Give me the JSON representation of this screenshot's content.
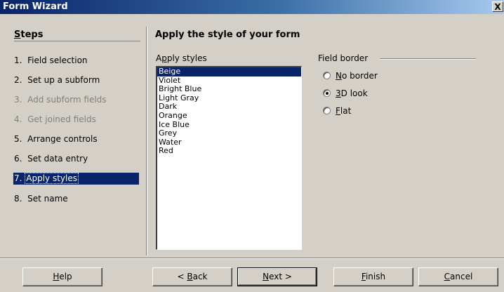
{
  "window": {
    "title": "Form Wizard",
    "close_label": "X"
  },
  "steps": {
    "title": "Steps",
    "items": [
      {
        "number": "1.",
        "label": "Field selection",
        "state": "enabled"
      },
      {
        "number": "2.",
        "label": "Set up a subform",
        "state": "enabled"
      },
      {
        "number": "3.",
        "label": "Add subform fields",
        "state": "disabled"
      },
      {
        "number": "4.",
        "label": "Get joined fields",
        "state": "disabled"
      },
      {
        "number": "5.",
        "label": "Arrange controls",
        "state": "enabled"
      },
      {
        "number": "6.",
        "label": "Set data entry",
        "state": "enabled"
      },
      {
        "number": "7.",
        "label": "Apply styles",
        "state": "selected"
      },
      {
        "number": "8.",
        "label": "Set name",
        "state": "enabled"
      }
    ]
  },
  "main": {
    "heading": "Apply the style of your form",
    "styles_label": "Apply styles",
    "styles": [
      "Beige",
      "Violet",
      "Bright Blue",
      "Light Gray",
      "Dark",
      "Orange",
      "Ice Blue",
      "Grey",
      "Water",
      "Red"
    ],
    "selected_style": "Beige",
    "field_border": {
      "label": "Field border",
      "options": [
        "No border",
        "3D look",
        "Flat"
      ],
      "selected": "3D look"
    }
  },
  "buttons": {
    "help": "Help",
    "back": "< Back",
    "next": "Next >",
    "finish": "Finish",
    "cancel": "Cancel"
  },
  "colors": {
    "selection": "#0a246a",
    "dialog_bg": "#d4d0c8",
    "disabled_text": "#808080"
  }
}
